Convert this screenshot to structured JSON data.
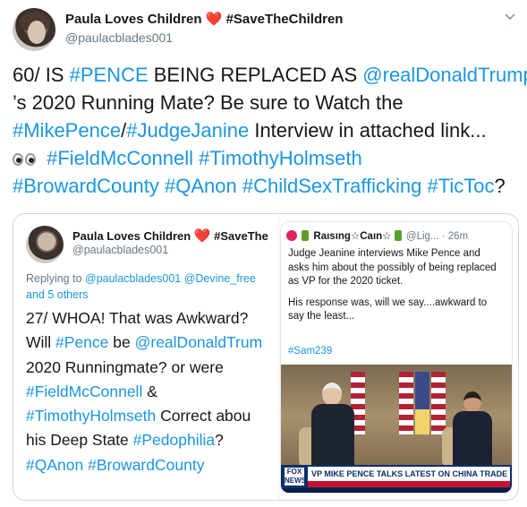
{
  "tweet": {
    "author": {
      "display_name": "Paula Loves Children",
      "heart": "❤️",
      "name_suffix": "#SaveTheChildren",
      "handle": "@paulacblades001",
      "avatar_icon": "profile-photo-child"
    },
    "menu_icon": "chevron-down-icon",
    "body_lines": [
      [
        {
          "text": "60/ IS ",
          "link": false
        },
        {
          "text": "#PENCE",
          "link": true
        },
        {
          "text": " BEING REPLACED AS ",
          "link": false
        },
        {
          "text": "@realDonaldTrump",
          "link": true
        }
      ],
      [
        {
          "text": "’s 2020 Running Mate? Be sure to Watch the",
          "link": false
        }
      ],
      [
        {
          "text": "#MikePence",
          "link": true
        },
        {
          "text": "/",
          "link": false
        },
        {
          "text": "#JudgeJanine",
          "link": true
        },
        {
          "text": " Interview in attached link...",
          "link": false
        }
      ],
      [
        {
          "text": "#FieldMcConnell",
          "link": true
        },
        {
          "text": " ",
          "link": false
        },
        {
          "text": "#TimothyHolmseth",
          "link": true
        }
      ],
      [
        {
          "text": "#BrowardCounty",
          "link": true
        },
        {
          "text": " ",
          "link": false
        },
        {
          "text": "#QAnon",
          "link": true
        },
        {
          "text": " ",
          "link": false
        },
        {
          "text": "#ChildSexTrafficking",
          "link": true
        },
        {
          "text": " ",
          "link": false
        },
        {
          "text": "#TicToc",
          "link": true
        },
        {
          "text": "?",
          "link": false
        }
      ]
    ],
    "eyes_emoji": "👀"
  },
  "embedded": {
    "left": {
      "display_name": "Paula Loves Children",
      "heart": "❤️",
      "name_suffix": "#SaveThe",
      "handle": "@paulacblades001",
      "reply_lines": [
        [
          {
            "text": "Replying to ",
            "link": false
          },
          {
            "text": "@paulacblades001",
            "link": true
          },
          {
            "text": " ",
            "link": false
          },
          {
            "text": "@Devine_free",
            "link": true
          }
        ],
        [
          {
            "text": "and 5 others",
            "link": true
          }
        ]
      ],
      "text_lines": [
        [
          {
            "text": "27/ WHOA! That was Awkward?",
            "link": false
          }
        ],
        [
          {
            "text": "Will ",
            "link": false
          },
          {
            "text": "#Pence",
            "link": true
          },
          {
            "text": " be ",
            "link": false
          },
          {
            "text": "@realDonaldTrum",
            "link": true
          }
        ],
        [
          {
            "text": "2020 Runningmate? or were",
            "link": false
          }
        ],
        [
          {
            "text": "#FieldMcConnell",
            "link": true
          },
          {
            "text": " &",
            "link": false
          }
        ],
        [
          {
            "text": "#TimothyHolmseth",
            "link": true
          },
          {
            "text": " Correct abou",
            "link": false
          }
        ],
        [
          {
            "text": "his Deep State ",
            "link": false
          },
          {
            "text": "#Pedophilia",
            "link": true
          },
          {
            "text": "?",
            "link": false
          }
        ],
        [
          {
            "text": "#QAnon",
            "link": true
          },
          {
            "text": " ",
            "link": false
          },
          {
            "text": "#BrowardCounty",
            "link": true
          }
        ]
      ]
    },
    "right": {
      "name": "Raısıng☆Caın☆",
      "handle_time": "@Lig... · 26m",
      "para1": [
        "Judge Jeanine interviews Mike Pence and",
        "asks him about the possibly of being replaced",
        "as VP for the 2020 ticket."
      ],
      "para2": [
        "His response was, will we say....awkward to",
        "say the least..."
      ],
      "hashtag": "#Sam239",
      "video": {
        "network_logo": "FOX NEWS",
        "headline": "VP MIKE PENCE TALKS LATEST ON CHINA TRADE DEAL"
      }
    }
  }
}
